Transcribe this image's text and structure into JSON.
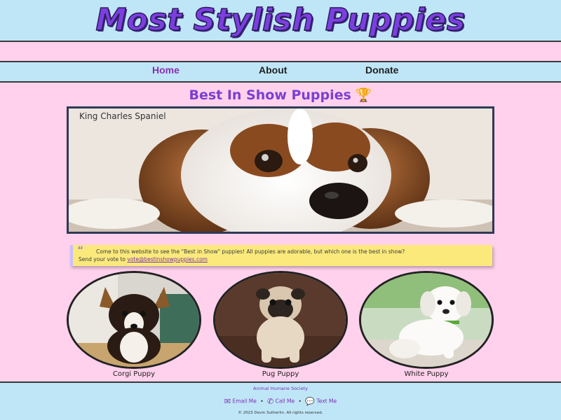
{
  "site": {
    "title": "Most Stylish Puppies"
  },
  "nav": {
    "home": "Home",
    "about": "About",
    "donate": "Donate"
  },
  "main": {
    "section_title": "Best In Show Puppies",
    "trophy_icon": "trophy-icon",
    "hero": {
      "label": "King Charles Spaniel"
    },
    "quote": {
      "line1": "Come to this website to see the \"Best in Show\" puppies! All puppies are adorable, but which one is the best in show?",
      "line2_prefix": "Send your vote to ",
      "email": "vote@bestinshowpuppies.com"
    },
    "puppies": [
      {
        "caption": "Corgi Puppy"
      },
      {
        "caption": "Pug Puppy"
      },
      {
        "caption": "White Puppy"
      }
    ]
  },
  "footer": {
    "org": "Animal Humane Society",
    "email_label": "Email Me",
    "call_label": "Call Me",
    "text_label": "Text Me",
    "separator": "•",
    "copyright": "© 2023 Devin Sutherlin. All rights reserved."
  },
  "colors": {
    "page_bg": "#ffd1ec",
    "header_bg": "#bfe6f7",
    "title": "#7b3fe0",
    "active_nav": "#8a2fb0",
    "quote_bg": "#fbe97c"
  }
}
